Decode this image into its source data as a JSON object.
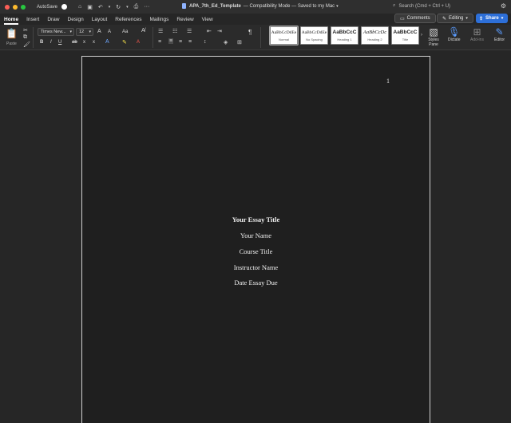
{
  "titlebar": {
    "autosave_label": "AutoSave",
    "doc_name": "APA_7th_Ed_Template",
    "doc_status": "— Compatibility Mode — Saved to my Mac",
    "search_placeholder": "Search (Cmd + Ctrl + U)"
  },
  "tabs": [
    "Home",
    "Insert",
    "Draw",
    "Design",
    "Layout",
    "References",
    "Mailings",
    "Review",
    "View"
  ],
  "active_tab": "Home",
  "actions": {
    "comments": "Comments",
    "editing": "Editing",
    "share": "Share"
  },
  "ribbon": {
    "paste_label": "Paste",
    "font_name": "Times New...",
    "font_size": "12",
    "grow_font": "A",
    "shrink_font": "A",
    "change_case": "Aa",
    "bold": "B",
    "italic": "I",
    "underline": "U",
    "strike": "ab",
    "subscript": "x",
    "superscript": "x",
    "highlight": "A",
    "font_color": "A",
    "pilcrow": "¶",
    "styles_pane": "Styles Pane",
    "dictate": "Dictate",
    "addins": "Add-ins",
    "editor": "Editor"
  },
  "styles": [
    {
      "sample": "AaBbCcDdEe",
      "name": "Normal"
    },
    {
      "sample": "AaBbCcDdEe",
      "name": "No Spacing"
    },
    {
      "sample": "AaBbCcC",
      "name": "Heading 1"
    },
    {
      "sample": "AaBbCcDc",
      "name": "Heading 2"
    },
    {
      "sample": "AaBbCcC",
      "name": "Title"
    }
  ],
  "document": {
    "page_number": "1",
    "title": "Your Essay Title",
    "author": "Your Name",
    "course": "Course Title",
    "instructor": "Instructor Name",
    "date": "Date Essay Due"
  }
}
